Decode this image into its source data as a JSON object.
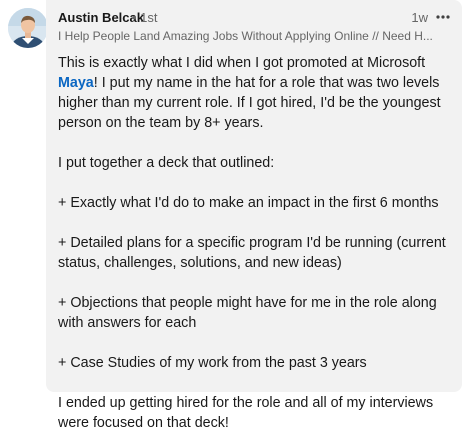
{
  "comment": {
    "author_name": "Austin Belcak",
    "degree": "• 1st",
    "time_ago": "1w",
    "headline": "I Help People Land Amazing Jobs Without Applying Online // Need H...",
    "body": {
      "p1_before_mention": "This is exactly what I did when I got promoted at Microsoft ",
      "mention": "Maya",
      "p1_after_mention": "! I put my name in the hat for a role that was two levels higher than my current role. If I got hired, I'd be the youngest person on the team by 8+ years.",
      "p2": "I put together a deck that outlined:",
      "p3": "+ Exactly what I'd do to make an impact in the first 6 months",
      "p4": "+ Detailed plans for a specific program I'd be running (current status, challenges, solutions, and new ideas)",
      "p5": "+ Objections that people might have for me in the role along with answers for each",
      "p6": "+ Case Studies of my work from the past 3 years",
      "p7": "I ended up getting hired for the role and all of my interviews were focused on that deck!"
    }
  },
  "icons": {
    "avatar": "avatar-photo",
    "more": "more-horizontal-icon"
  },
  "colors": {
    "bubble_bg": "#f2f2f2",
    "mention": "#0a66c2",
    "text": "#191919",
    "secondary": "#666666"
  }
}
